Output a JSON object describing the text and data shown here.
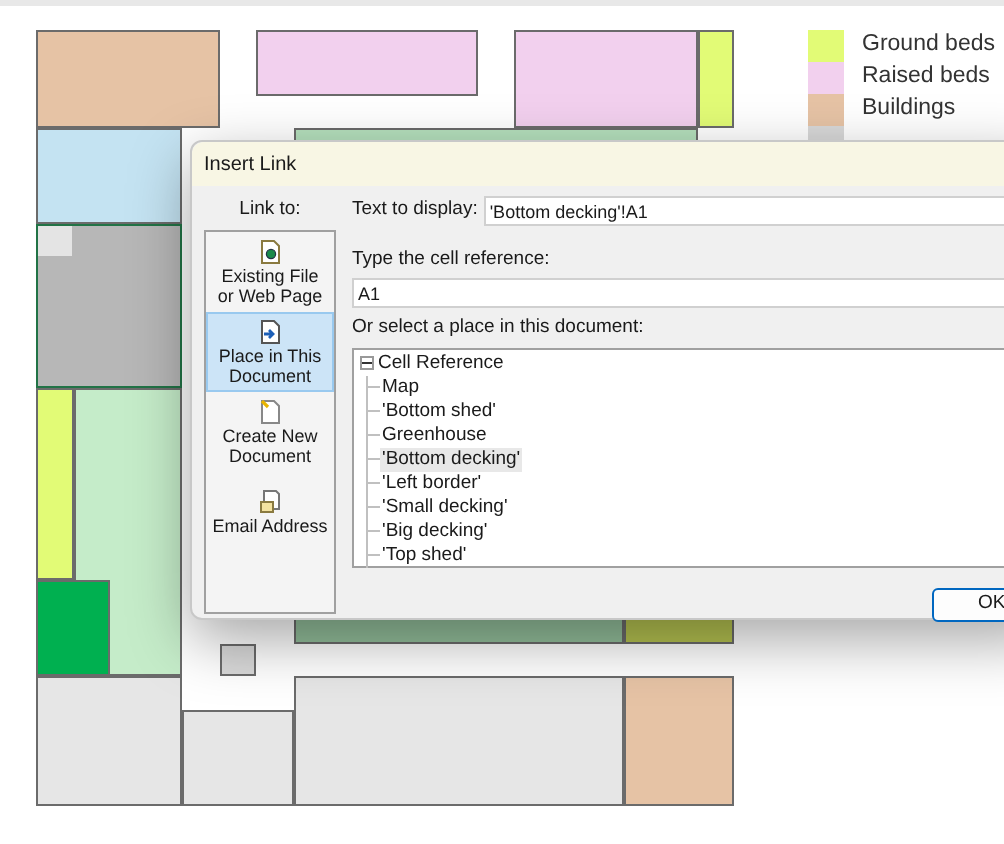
{
  "legend": [
    {
      "label": "Ground beds",
      "color": "#e2fb76"
    },
    {
      "label": "Raised beds",
      "color": "#f2d0ee"
    },
    {
      "label": "Buildings",
      "color": "#e6c3a5"
    }
  ],
  "dialog": {
    "title": "Insert Link",
    "link_to_label": "Link to:",
    "link_targets": [
      {
        "label": "Existing File or Web Page",
        "kind": "file",
        "selected": false
      },
      {
        "label": "Place in This Document",
        "kind": "place",
        "selected": true
      },
      {
        "label": "Create New Document",
        "kind": "new",
        "selected": false
      },
      {
        "label": "Email Address",
        "kind": "email",
        "selected": false
      }
    ],
    "text_to_display": {
      "label": "Text to display:",
      "value": "'Bottom decking'!A1"
    },
    "cell_reference": {
      "label": "Type the cell reference:",
      "value": "A1"
    },
    "place_label": "Or select a place in this document:",
    "tree": {
      "label": "Cell Reference",
      "expanded": true,
      "children": [
        {
          "label": "Map",
          "selected": false
        },
        {
          "label": "'Bottom shed'",
          "selected": false
        },
        {
          "label": "Greenhouse",
          "selected": false
        },
        {
          "label": "'Bottom decking'",
          "selected": true
        },
        {
          "label": "'Left border'",
          "selected": false
        },
        {
          "label": "'Small decking'",
          "selected": false
        },
        {
          "label": "'Big decking'",
          "selected": false
        },
        {
          "label": "'Top shed'",
          "selected": false
        }
      ]
    },
    "buttons": [
      "OK"
    ]
  }
}
